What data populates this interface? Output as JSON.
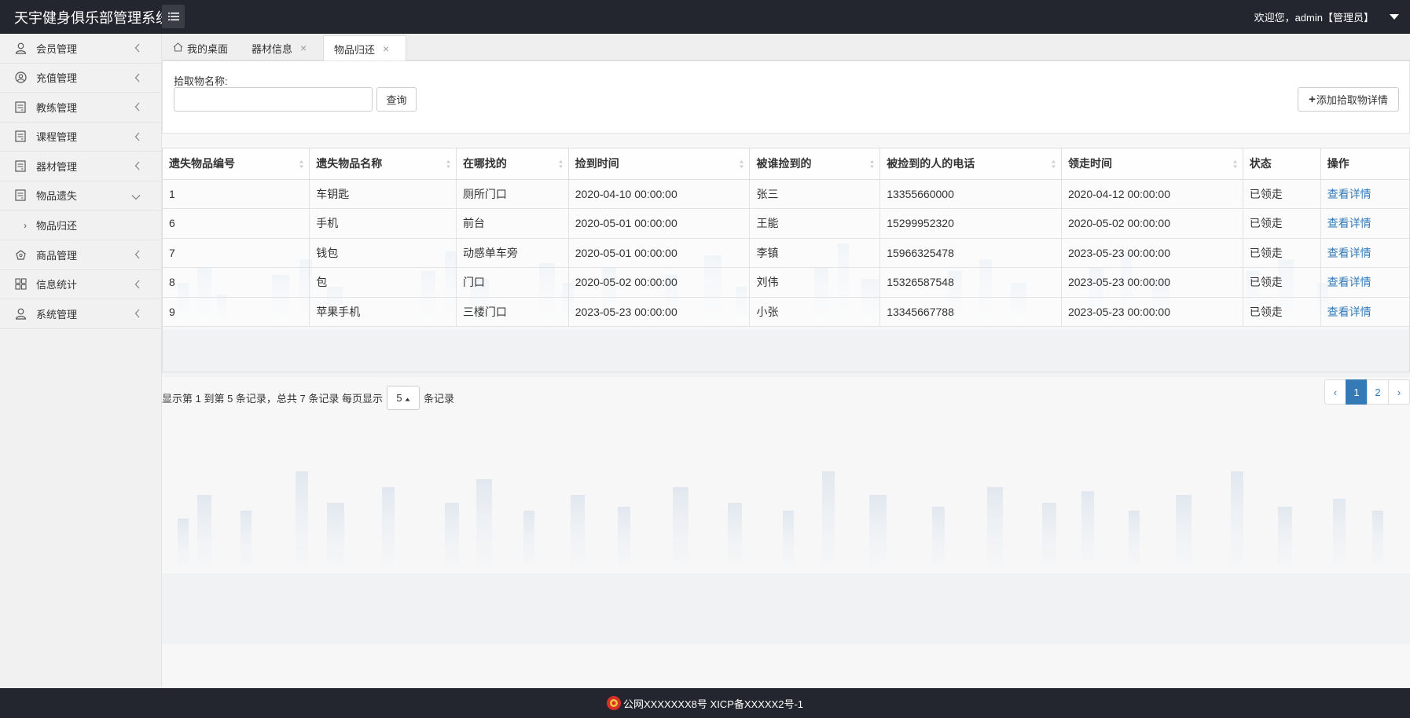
{
  "header": {
    "title": "天宇健身俱乐部管理系统",
    "welcome": "欢迎您，admin【管理员】"
  },
  "sidebar": {
    "items": [
      {
        "label": "会员管理",
        "icon": "user-icon"
      },
      {
        "label": "充值管理",
        "icon": "user-circle-icon"
      },
      {
        "label": "教练管理",
        "icon": "document-icon"
      },
      {
        "label": "课程管理",
        "icon": "document-icon"
      },
      {
        "label": "器材管理",
        "icon": "document-icon"
      },
      {
        "label": "物品遗失",
        "icon": "document-icon"
      },
      {
        "label": "商品管理",
        "icon": "gift-icon"
      },
      {
        "label": "信息统计",
        "icon": "grid-icon"
      },
      {
        "label": "系统管理",
        "icon": "user-icon"
      }
    ],
    "sub_item": "物品归还"
  },
  "tabs": [
    {
      "label": "我的桌面"
    },
    {
      "label": "器材信息"
    },
    {
      "label": "物品归还"
    }
  ],
  "search": {
    "label": "拾取物名称:",
    "value": "",
    "query_button": "查询",
    "add_button": "添加拾取物详情"
  },
  "table": {
    "columns": [
      "遗失物品编号",
      "遗失物品名称",
      "在哪找的",
      "捡到时间",
      "被谁捡到的",
      "被捡到的人的电话",
      "领走时间",
      "状态",
      "操作"
    ],
    "rows": [
      [
        "1",
        "车钥匙",
        "厕所门口",
        "2020-04-10 00:00:00",
        "张三",
        "13355660000",
        "2020-04-12 00:00:00",
        "已领走",
        "查看详情"
      ],
      [
        "6",
        "手机",
        "前台",
        "2020-05-01 00:00:00",
        "王能",
        "15299952320",
        "2020-05-02 00:00:00",
        "已领走",
        "查看详情"
      ],
      [
        "7",
        "钱包",
        "动感单车旁",
        "2020-05-01 00:00:00",
        "李镇",
        "15966325478",
        "2023-05-23 00:00:00",
        "已领走",
        "查看详情"
      ],
      [
        "8",
        "包",
        "门口",
        "2020-05-02 00:00:00",
        "刘伟",
        "15326587548",
        "2023-05-23 00:00:00",
        "已领走",
        "查看详情"
      ],
      [
        "9",
        "苹果手机",
        "三楼门口",
        "2023-05-23 00:00:00",
        "小张",
        "13345667788",
        "2023-05-23 00:00:00",
        "已领走",
        "查看详情"
      ]
    ]
  },
  "pagination": {
    "info_prefix": "显示第 1 到第 5 条记录，总共 7 条记录 每页显示",
    "page_size": "5",
    "info_suffix": "条记录",
    "prev": "‹",
    "pages": [
      "1",
      "2"
    ],
    "next": "›",
    "active_page": "1"
  },
  "footer": {
    "text": "公网XXXXXXX8号 XICP备XXXXX2号-1"
  },
  "colors": {
    "header_bg": "#23262e",
    "link": "#337ab7",
    "active_page": "#337ab7"
  }
}
